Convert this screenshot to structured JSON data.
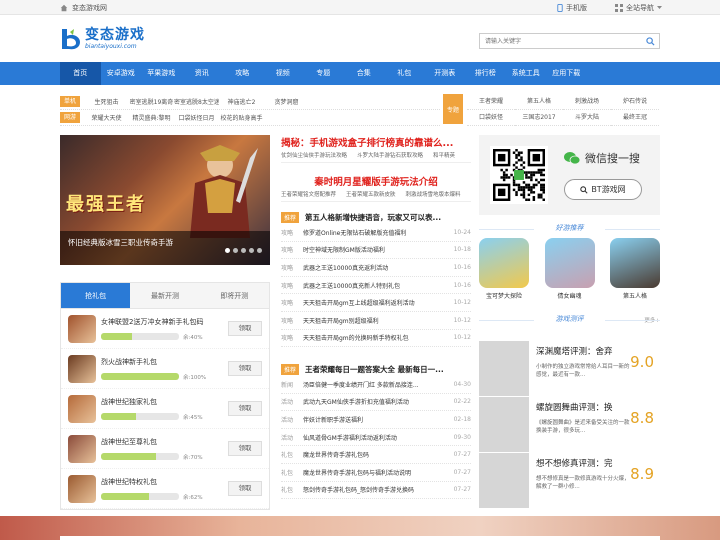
{
  "topbar": {
    "site_name": "变态游戏网",
    "mobile": "手机版",
    "nav_all": "全站导航"
  },
  "header": {
    "logo_cn": "变态游戏",
    "logo_en": "biantaiyouxi.com",
    "search_placeholder": "请输入关键字"
  },
  "nav": [
    "首页",
    "安卓游戏",
    "苹果游戏",
    "资讯",
    "攻略",
    "视频",
    "专题",
    "合集",
    "礼包",
    "开测表",
    "排行榜",
    "系统工具",
    "应用下载"
  ],
  "quick": {
    "rows": [
      {
        "tag": "单机",
        "color": "#f0a33d",
        "items": [
          "生死狙击",
          "密室逃脱19离奇",
          "密室逃脱8太空迷",
          "神庙逃亡2",
          "贪梦洞窟"
        ]
      },
      {
        "tag": "网游",
        "color": "#f0a33d",
        "items": [
          "荣耀大天使",
          "精灵盛典:黎明",
          "口袋妖怪日月",
          "校花的贴身高手",
          ""
        ]
      }
    ]
  },
  "special": {
    "tag": "专题",
    "items": [
      "王者荣耀",
      "第五人格",
      "刺激战场",
      "炉石传说",
      "口袋妖怪",
      "三国志2017",
      "斗罗大陆",
      "最终王冠"
    ]
  },
  "banner": {
    "title_art": "最强王者",
    "caption": "怀旧经典版冰雪三职业传奇手游"
  },
  "headlines": {
    "h1": "揭秘：手机游戏盒子排行榜真的靠谱么...",
    "sub1": [
      "仗剑仙尘仙侠手游玩法攻略",
      "斗罗大陆手游钻石获取攻略",
      "和平精英"
    ],
    "h2": "秦时明月星耀版手游玩法介绍",
    "sub2": [
      "王者荣耀铭文搭配推荐",
      "王者荣耀五款新皮肤",
      "刺激战场雪地版本爆料"
    ]
  },
  "news1": {
    "tag": "推荐",
    "title": "第五人格新增快捷语音，玩家又可以表...",
    "rows": [
      {
        "cat": "攻略",
        "title": "修罗道Online无限钻石破解版充值福利",
        "date": "10-24"
      },
      {
        "cat": "攻略",
        "title": "时空神域无限制GM版活动福利",
        "date": "10-18"
      },
      {
        "cat": "攻略",
        "title": "武器之王送10000真充返利活动",
        "date": "10-16"
      },
      {
        "cat": "攻略",
        "title": "武器之王送10000真充新人特别礼包",
        "date": "10-16"
      },
      {
        "cat": "攻略",
        "title": "天天狙击开局gm互上线超级福利返利活动",
        "date": "10-12"
      },
      {
        "cat": "攻略",
        "title": "天天狙击开局gm别超级福利",
        "date": "10-12"
      },
      {
        "cat": "攻略",
        "title": "天天狙击开局gm的兑换码新手特权礼包",
        "date": "10-12"
      }
    ]
  },
  "news2": {
    "tag": "推荐",
    "title": "王者荣耀每日一题答案大全 最新每日一...",
    "rows": [
      {
        "cat": "新闻",
        "title": "汤臣倍健一季度业绩开门红 多款新品接连...",
        "date": "04-30"
      },
      {
        "cat": "活动",
        "title": "武动九天GM仙侠手游折扣充值福利活动",
        "date": "02-22"
      },
      {
        "cat": "活动",
        "title": "伴妖计新职手游送福利",
        "date": "02-18"
      },
      {
        "cat": "活动",
        "title": "仙风道骨GM手游福利活动返利活动",
        "date": "09-30"
      },
      {
        "cat": "礼包",
        "title": "魔龙世界传奇手游礼包码",
        "date": "07-27"
      },
      {
        "cat": "礼包",
        "title": "魔龙世界传奇手游礼包码与福利活动说明",
        "date": "07-27"
      },
      {
        "cat": "礼包",
        "title": "怒剑传奇手游礼包码_怒剑传奇手游兑换码",
        "date": "07-27"
      }
    ]
  },
  "gift": {
    "tabs": [
      "抢礼包",
      "最新开测",
      "即将开测"
    ],
    "button": "领取",
    "items": [
      {
        "name": "女神联盟2送万冲女神新手礼包码",
        "pct_label": "余:40%",
        "pct": 40,
        "color": "#a0522d"
      },
      {
        "name": "烈火战神新手礼包",
        "pct_label": "余:100%",
        "pct": 100,
        "color": "#6a3a20"
      },
      {
        "name": "战神世纪独家礼包",
        "pct_label": "余:45%",
        "pct": 45,
        "color": "#b56a3a"
      },
      {
        "name": "战神世纪至尊礼包",
        "pct_label": "余:70%",
        "pct": 70,
        "color": "#8a4a3a"
      },
      {
        "name": "战神世纪特权礼包",
        "pct_label": "余:62%",
        "pct": 62,
        "color": "#9a5a30"
      }
    ]
  },
  "wechat": {
    "title": "微信搜一搜",
    "account": "BT游戏网"
  },
  "good_games": {
    "title": "好游推荐",
    "items": [
      {
        "name": "宝可梦大探险",
        "color": "#f2c94c"
      },
      {
        "name": "倩女幽魂",
        "color": "#c8a0b0"
      },
      {
        "name": "第五人格",
        "color": "#4a3a30"
      }
    ]
  },
  "reviews": {
    "title": "游戏测评",
    "more": "更多+",
    "items": [
      {
        "title": "深渊魔塔评测：舍弃",
        "desc": "小制作的独立游戏常常给人耳目一新的感觉，最近有一款...",
        "score": "9.0"
      },
      {
        "title": "螺旋圆舞曲评测：换",
        "desc": "《螺旋圆舞曲》是近来备受关注的一款换装手游，很多玩...",
        "score": "8.8"
      },
      {
        "title": "想不想修真评测：完",
        "desc": "想不想修真是一款修真游戏十分火爆，解救了一群小修...",
        "score": "8.9"
      }
    ]
  }
}
